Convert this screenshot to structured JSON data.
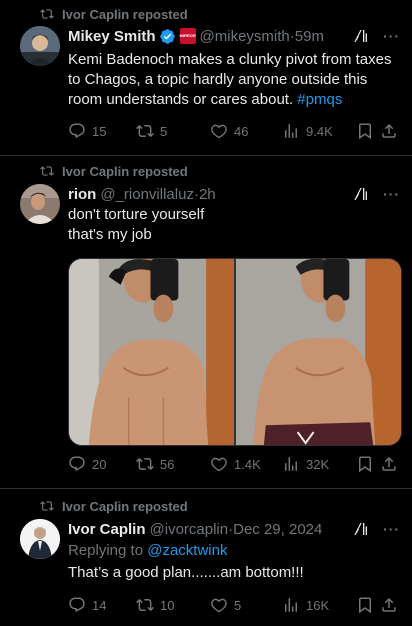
{
  "tweets": [
    {
      "repost_label": "Ivor Caplin reposted",
      "name": "Mikey Smith",
      "aff_badge_text": "MIRROR",
      "handle": "@mikeysmith",
      "time": "59m",
      "text": "Kemi Badenoch makes a clunky pivot from taxes to Chagos, a topic hardly anyone outside this room understands or cares about. ",
      "hashtag": "#pmqs",
      "replies": "15",
      "reposts": "5",
      "likes": "46",
      "views": "9.4K"
    },
    {
      "repost_label": "Ivor Caplin reposted",
      "name": "rion",
      "handle": "@_rionvillaluz",
      "time": "2h",
      "text_line1": "don't torture yourself",
      "text_line2": "that's my job",
      "replies": "20",
      "reposts": "56",
      "likes": "1.4K",
      "views": "32K"
    },
    {
      "repost_label": "Ivor Caplin reposted",
      "name": "Ivor Caplin",
      "handle": "@ivorcaplin",
      "time": "Dec 29, 2024",
      "replying_prefix": "Replying to ",
      "replying_to": "@zacktwink",
      "text": "That’s a good plan.......am bottom!!!",
      "replies": "14",
      "reposts": "10",
      "likes": "5",
      "views": "16K"
    }
  ],
  "separator": " · ",
  "icons": {
    "repost": "repost-icon",
    "reply": "reply-icon",
    "like": "heart-icon",
    "views": "views-icon",
    "bookmark": "bookmark-icon",
    "share": "share-icon",
    "grok": "grok-icon",
    "more": "more-icon",
    "verified": "verified-badge-icon"
  },
  "colors": {
    "background": "#000000",
    "text": "#e7e9ea",
    "muted": "#71767b",
    "link": "#1d9bf0",
    "divider": "#2f3336"
  }
}
